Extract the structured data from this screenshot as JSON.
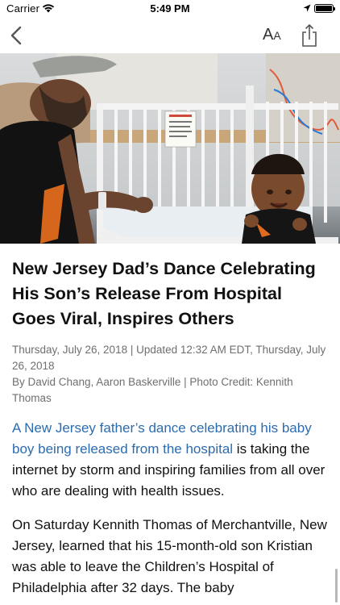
{
  "status_bar": {
    "carrier": "Carrier",
    "time": "5:49 PM"
  },
  "nav": {
    "text_size_big": "A",
    "text_size_small": "A"
  },
  "article": {
    "headline": "New Jersey Dad’s Dance Celebrating His Son’s Release From Hospital Goes Viral, Inspires Others",
    "dateline": "Thursday, July 26, 2018 | Updated 12:32 AM EDT, Thursday, July 26, 2018",
    "byline": "By David Chang, Aaron Baskerville | Photo Credit: Kennith Thomas",
    "p1_link": "A New Jersey father’s dance celebrating his baby boy being released from the hospital",
    "p1_rest": " is taking the internet by storm and inspiring families from all over who are dealing with health issues.",
    "p2": "On Saturday Kennith Thomas of Merchantville, New Jersey, learned that his 15-month-old son Kristian was able to leave the Children’s Hospital of Philadelphia after 32 days. The baby"
  },
  "icons": {
    "back": "chevron-left-icon",
    "text_size": "text-size-icon",
    "share": "share-icon",
    "wifi": "wifi-icon",
    "location": "location-arrow-icon",
    "battery": "battery-icon"
  },
  "colors": {
    "link": "#2b6cb0",
    "meta": "#6f6f6f",
    "headline": "#111111"
  }
}
